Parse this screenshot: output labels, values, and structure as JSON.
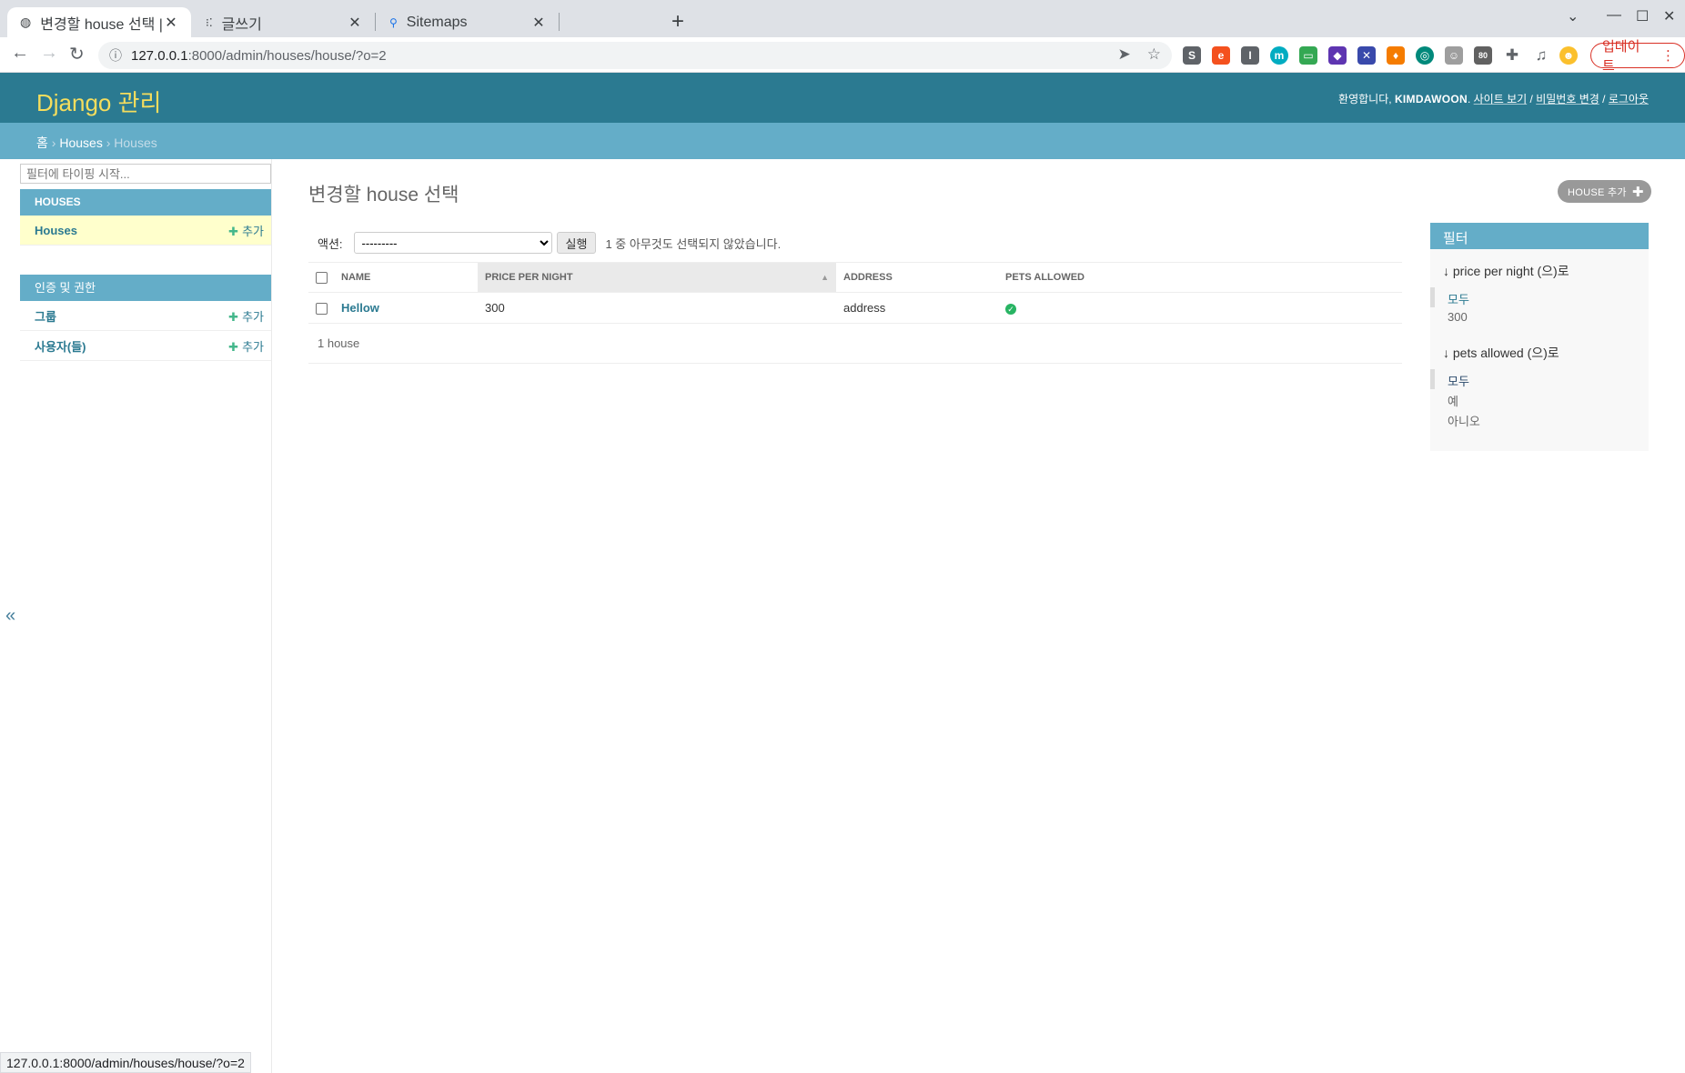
{
  "browser": {
    "tabs": [
      {
        "title": "변경할 house 선택 | Django",
        "icon": "globe-icon"
      },
      {
        "title": "글쓰기",
        "icon": "dots-icon"
      },
      {
        "title": "Sitemaps",
        "icon": "sitemap-icon"
      }
    ],
    "url_host": "127.0.0.1",
    "url_path": ":8000/admin/houses/house/?o=2",
    "update_label": "업데이트",
    "status_url": "127.0.0.1:8000/admin/houses/house/?o=2"
  },
  "header": {
    "branding": "Django 관리",
    "welcome": "환영합니다,",
    "username": "KIMDAWOON",
    "view_site": "사이트 보기",
    "change_password": "비밀번호 변경",
    "logout": "로그아웃",
    "separator": "/"
  },
  "breadcrumbs": {
    "home": "홈",
    "app": "Houses",
    "current": "Houses",
    "sep": "›"
  },
  "sidebar": {
    "filter_placeholder": "필터에 타이핑 시작...",
    "modules": [
      {
        "caption": "HOUSES",
        "rows": [
          {
            "label": "Houses",
            "add": "추가"
          }
        ]
      },
      {
        "caption": "인증 및 권한",
        "rows": [
          {
            "label": "그룹",
            "add": "추가"
          },
          {
            "label": "사용자(들)",
            "add": "추가"
          }
        ]
      }
    ],
    "collapse": "«"
  },
  "content": {
    "title": "변경할 house 선택",
    "add_button": "HOUSE 추가",
    "action_label": "액션:",
    "action_selected": "---------",
    "go_label": "실행",
    "counter": "1 중 아무것도 선택되지 않았습니다.",
    "columns": [
      "NAME",
      "PRICE PER NIGHT",
      "ADDRESS",
      "PETS ALLOWED"
    ],
    "rows": [
      {
        "name": "Hellow",
        "price": "300",
        "address": "address",
        "pets_allowed": true
      }
    ],
    "paginator": "1 house"
  },
  "filter": {
    "title": "필터",
    "groups": [
      {
        "title": "↓ price per night (으)로",
        "items": [
          "모두",
          "300"
        ]
      },
      {
        "title": "↓ pets allowed (으)로",
        "items": [
          "모두",
          "예",
          "아니오"
        ]
      }
    ]
  },
  "colors": {
    "header": "#2b7a91",
    "breadcrumbs": "#64adc8",
    "branding": "#f5dd5d",
    "link": "#2b7a91",
    "add_green": "#44b78b"
  }
}
